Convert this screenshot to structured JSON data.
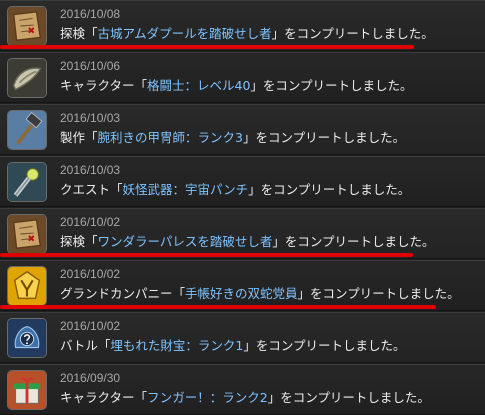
{
  "entries": [
    {
      "date": "2016/10/08",
      "prefix": "探検「",
      "title": "古城アムダプールを踏破せし者",
      "suffix": "」をコンプリートしました。",
      "icon": "treasure-map-icon"
    },
    {
      "date": "2016/10/06",
      "prefix": "キャラクター「",
      "title": "格闘士：レベル40",
      "suffix": "」をコンプリートしました。",
      "icon": "fist-weapon-icon"
    },
    {
      "date": "2016/10/03",
      "prefix": "製作「",
      "title": "腕利きの甲冑師：ランク3",
      "suffix": "」をコンプリートしました。",
      "icon": "hammer-icon"
    },
    {
      "date": "2016/10/03",
      "prefix": "クエスト「",
      "title": "妖怪武器：宇宙パンチ",
      "suffix": "」をコンプリートしました。",
      "icon": "yokai-weapon-icon"
    },
    {
      "date": "2016/10/02",
      "prefix": "探検「",
      "title": "ワンダラーパレスを踏破せし者",
      "suffix": "」をコンプリートしました。",
      "icon": "treasure-map-icon"
    },
    {
      "date": "2016/10/02",
      "prefix": "グランドカンパニー「",
      "title": "手帳好きの双蛇党員",
      "suffix": "」をコンプリートしました。",
      "icon": "grand-company-emblem-icon"
    },
    {
      "date": "2016/10/02",
      "prefix": "バトル「",
      "title": "埋もれた財宝：ランク1",
      "suffix": "」をコンプリートしました。",
      "icon": "mystery-treasure-icon"
    },
    {
      "date": "2016/09/30",
      "prefix": "キャラクター「",
      "title": "フンガー！：ランク2",
      "suffix": "」をコンプリートしました。",
      "icon": "character-gift-icon"
    }
  ],
  "colors": {
    "highlight": "#7ec3ff",
    "annotation": "#e00000",
    "text": "#ececec",
    "date": "#a8a8a8"
  }
}
